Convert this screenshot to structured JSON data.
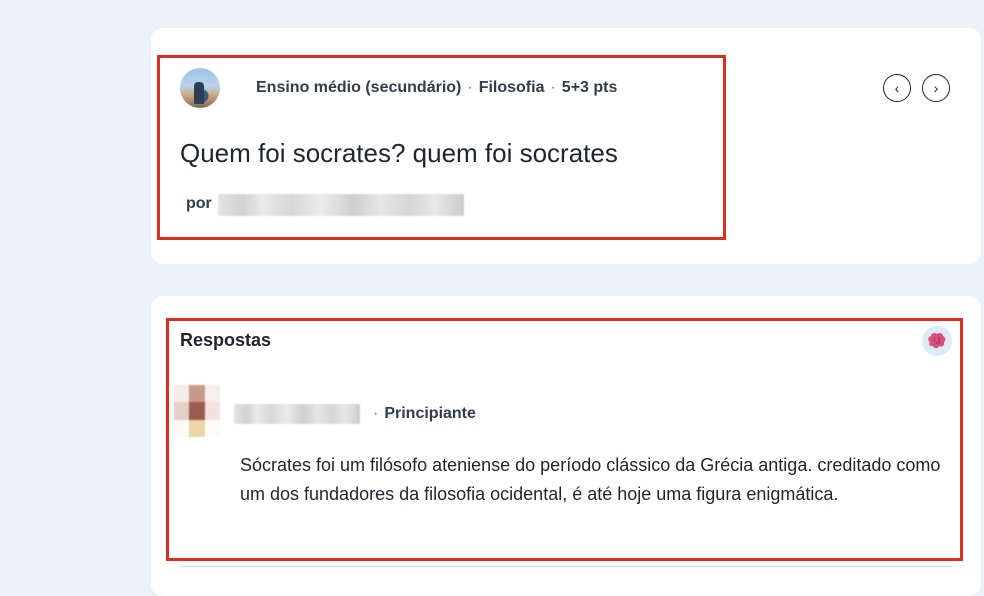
{
  "question": {
    "grade": "Ensino médio (secundário)",
    "subject": "Filosofia",
    "points": "5+3 pts",
    "text": "Quem foi socrates? quem foi socrates",
    "author_prefix": "por",
    "nav_prev": "‹",
    "nav_next": "›"
  },
  "answers": {
    "section_title": "Respostas",
    "items": [
      {
        "rank": "Principiante",
        "text": "Sócrates foi um filósofo ateniense do período clássico da Grécia antiga. creditado como um dos fundadores da filosofia ocidental, é até hoje uma figura enigmática."
      }
    ]
  },
  "colors": {
    "highlight": "#d6321f",
    "background": "#ebf1f8",
    "card": "#ffffff"
  },
  "icons": [
    "user-avatar-photo",
    "chevron-left-icon",
    "chevron-right-icon",
    "brain-icon",
    "answer-author-avatar"
  ]
}
